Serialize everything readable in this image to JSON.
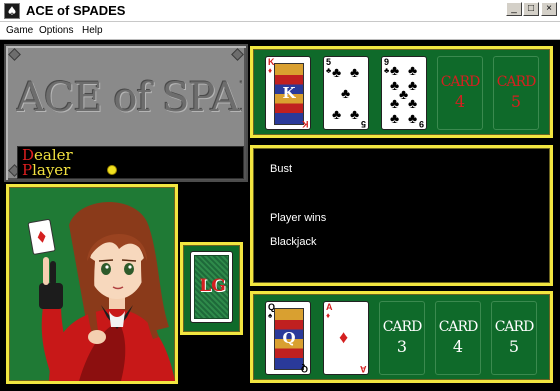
{
  "window": {
    "title": "ACE of SPADES",
    "minimize_glyph": "_",
    "maximize_glyph": "□",
    "close_glyph": "×"
  },
  "menu": [
    "Game",
    "Options",
    "Help"
  ],
  "logo": {
    "text": "ACE of SPADES"
  },
  "status": {
    "dealer_first": "D",
    "dealer_rest": "ealer",
    "player_first": "P",
    "player_rest": "layer",
    "active_turn": "player"
  },
  "dealer_hand": {
    "cards": [
      {
        "rank": "K",
        "suit": "♦",
        "suit_name": "diamonds",
        "color": "#d42020"
      },
      {
        "rank": "5",
        "suit": "♣",
        "suit_name": "clubs",
        "color": "#000000"
      },
      {
        "rank": "9",
        "suit": "♣",
        "suit_name": "clubs",
        "color": "#000000"
      }
    ],
    "empty_slots": [
      {
        "word": "CARD",
        "number": "4"
      },
      {
        "word": "CARD",
        "number": "5"
      }
    ],
    "slot_text_color": "#d42020"
  },
  "messages": [
    "Bust",
    "",
    "",
    "Player wins",
    "Blackjack"
  ],
  "deck": {
    "logo_text": "LG"
  },
  "player_hand": {
    "cards": [
      {
        "rank": "Q",
        "suit": "♠",
        "suit_name": "spades",
        "color": "#000000"
      },
      {
        "rank": "A",
        "suit": "♦",
        "suit_name": "diamonds",
        "color": "#d42020"
      }
    ],
    "empty_slots": [
      {
        "word": "CARD",
        "number": "3"
      },
      {
        "word": "CARD",
        "number": "4"
      },
      {
        "word": "CARD",
        "number": "5"
      }
    ],
    "slot_text_color": "#ffffff"
  },
  "colors": {
    "felt": "#0f6a2a",
    "frame": "#f2e640",
    "red_suit": "#d42020"
  }
}
